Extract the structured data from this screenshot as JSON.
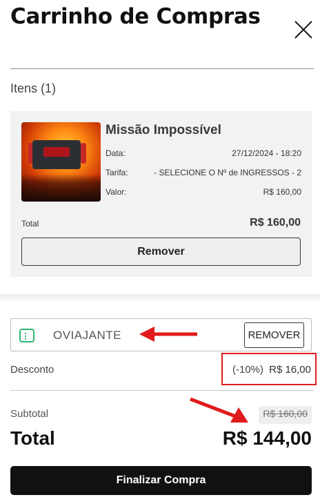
{
  "header": {
    "title": "Carrinho de Compras"
  },
  "items_section": {
    "title": "Itens (1)"
  },
  "item": {
    "name": "Missão Impossível",
    "date_label": "Data:",
    "date_value": "27/12/2024 - 18:20",
    "tarifa_label": "Tarifa:",
    "tarifa_value": "- SELECIONE O Nº de INGRESSOS - 2",
    "valor_label": "Valor:",
    "valor_value": "R$ 160,00",
    "total_label": "Total",
    "total_value": "R$ 160,00",
    "remove_label": "Remover"
  },
  "coupon": {
    "code": "OVIAJANTE",
    "remove_label": "REMOVER",
    "icon": "coupon-icon",
    "accent_color": "#2bb673"
  },
  "discount": {
    "label": "Desconto",
    "percent": "(-10%)",
    "value": "R$ 16,00",
    "highlight_color": "#e01b1b"
  },
  "summary": {
    "subtotal_label": "Subtotal",
    "subtotal_value": "R$ 160,00",
    "total_label": "Total",
    "total_value": "R$ 144,00"
  },
  "checkout": {
    "label": "Finalizar Compra"
  },
  "annotations": {
    "arrow_color": "#e01b1b"
  }
}
